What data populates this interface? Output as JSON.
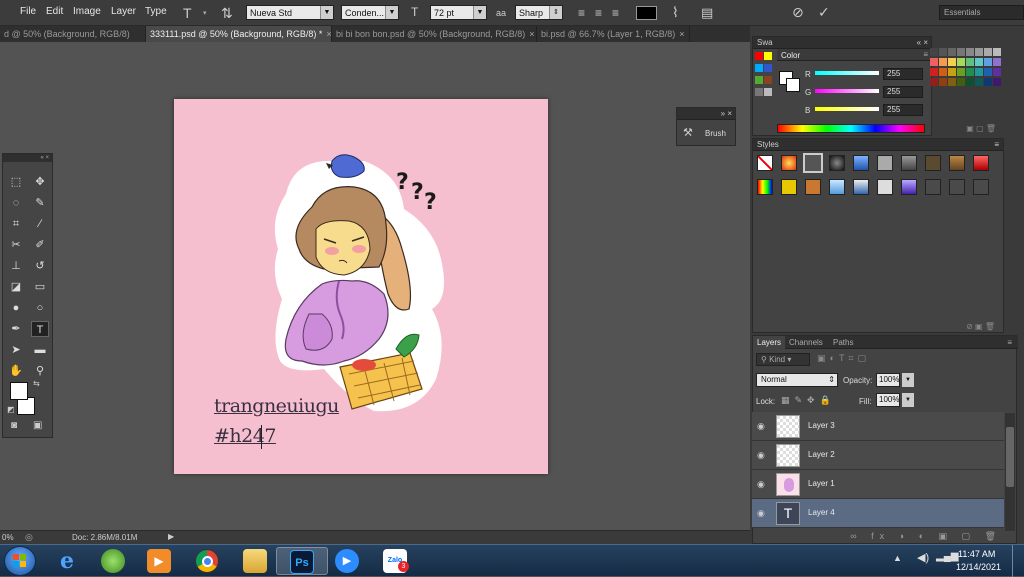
{
  "menubar": {
    "items": [
      "File",
      "Edit",
      "Image",
      "Layer",
      "Type"
    ],
    "font_family": "Nueva Std",
    "font_style": "Conden...",
    "font_size": "72 pt",
    "antialias": "Sharp",
    "workspace": "Essentials",
    "aa_glyph": "aa"
  },
  "tabs": [
    {
      "label": "d @ 50% (Background, RGB/8)",
      "active": false
    },
    {
      "label": "333111.psd @ 50% (Background, RGB/8) *",
      "active": true
    },
    {
      "label": "bi bi bon bon.psd @ 50% (Background, RGB/8)",
      "active": false
    },
    {
      "label": "bi.psd @ 66.7% (Layer 1, RGB/8)",
      "active": false
    }
  ],
  "canvas": {
    "line1": "trangneuiugu",
    "line2": "#h247",
    "bg_color": "#f6bfd0"
  },
  "brush_panel": {
    "label": "Brush"
  },
  "swatches_panel": {
    "title": "Swa"
  },
  "color_panel": {
    "title": "Color",
    "r_label": "R",
    "r": "255",
    "g_label": "G",
    "g": "255",
    "b_label": "B",
    "b": "255"
  },
  "styles_panel": {
    "title": "Styles"
  },
  "layers_panel": {
    "tabs": [
      "Layers",
      "Channels",
      "Paths"
    ],
    "kind": "Kind",
    "blend_mode": "Normal",
    "opacity_label": "Opacity:",
    "opacity": "100%",
    "lock_label": "Lock:",
    "fill_label": "Fill:",
    "fill": "100%",
    "layers": [
      {
        "name": "Layer 3",
        "selected": false
      },
      {
        "name": "Layer 2",
        "selected": false
      },
      {
        "name": "Layer 1",
        "selected": false
      },
      {
        "name": "Layer 4",
        "selected": true
      }
    ]
  },
  "status": {
    "zoom": "0%",
    "doc": "Doc: 2.86M/8.01M"
  },
  "taskbar": {
    "time": "11:47 AM",
    "date": "12/14/2021",
    "ps_label": "Ps",
    "zalo_label": "Zalo",
    "zalo_badge": "3",
    "ie_label": "e"
  }
}
